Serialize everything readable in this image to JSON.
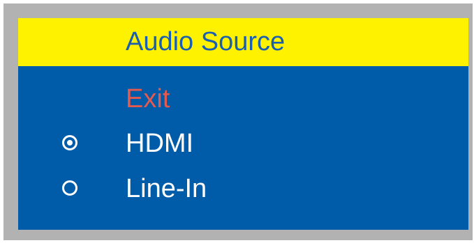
{
  "menu": {
    "title": "Audio Source",
    "exit_label": "Exit",
    "options": [
      {
        "label": "HDMI",
        "selected": true
      },
      {
        "label": "Line-In",
        "selected": false
      }
    ]
  },
  "colors": {
    "frame": "#b2b2b2",
    "panel": "#005ca8",
    "title_bar": "#fff200",
    "title_text": "#1a5fb0",
    "exit_text": "#e45a4f",
    "option_text": "#ffffff"
  },
  "icons": {
    "selected": "radio-selected-icon",
    "unselected": "radio-unselected-icon"
  }
}
